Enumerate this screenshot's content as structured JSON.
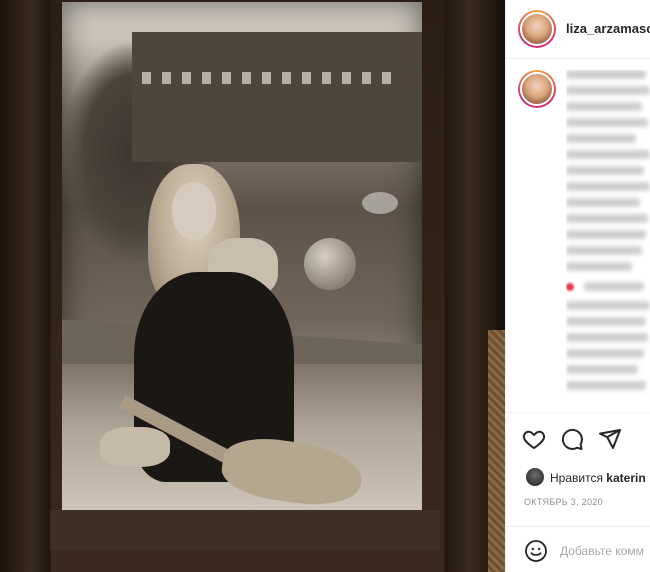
{
  "post": {
    "username": "liza_arzamaso",
    "caption_blurred": true,
    "likes_prefix": "Нравится",
    "likes_user": "katerin",
    "date": "октябрь 3, 2020"
  },
  "comment": {
    "placeholder": "Добавьте комм"
  },
  "icons": {
    "like": "heart-icon",
    "comment": "comment-icon",
    "share": "share-icon",
    "emoji": "emoji-icon"
  },
  "colors": {
    "accent_gradient": [
      "#f9a23b",
      "#e1306c",
      "#c13584"
    ],
    "muted_text": "#8e8e8e",
    "divider": "#efefef"
  }
}
